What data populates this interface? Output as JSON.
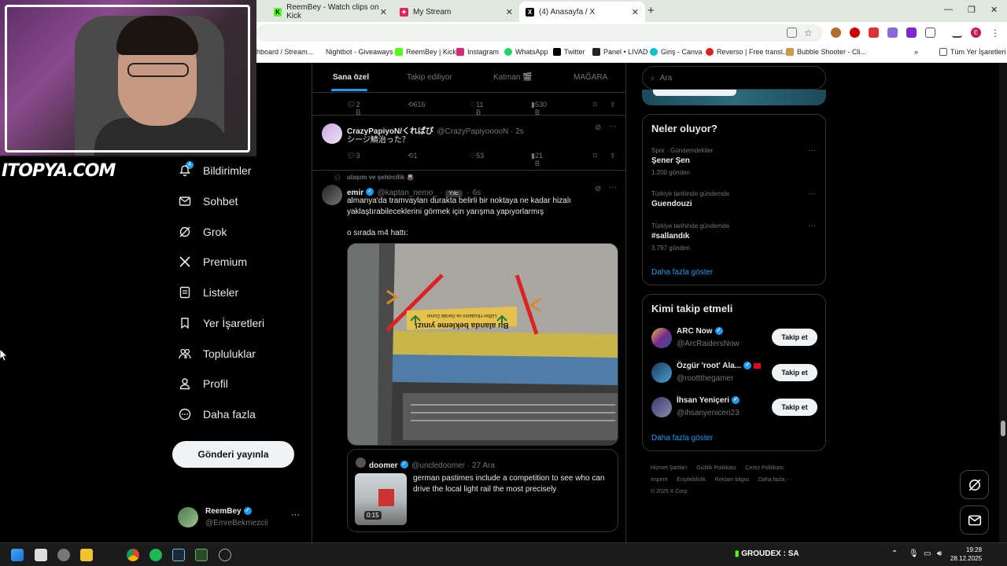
{
  "browser": {
    "tabs": [
      {
        "label": "ReemBey - Watch clips on Kick",
        "fav": "K"
      },
      {
        "label": "My Stream",
        "fav": "✦"
      },
      {
        "label": "(4) Anasayfa / X",
        "fav": "X"
      }
    ],
    "bookmarks": [
      "hboard / Stream...",
      "Nightbot - Giveaways",
      "ReemBey | Kick",
      "Instagram",
      "WhatsApp",
      "Twitter",
      "Panel • LIVAD",
      "Giriş - Canva",
      "Reverso | Free transl...",
      "Bubble Shooter - Cli...",
      "Tüm Yer İşaretleri"
    ],
    "profile_initial": "E"
  },
  "overlay": {
    "logo_text": "ITOPYA.COM"
  },
  "nav": {
    "notif_badge": "4",
    "items": [
      "Bildirimler",
      "Sohbet",
      "Grok",
      "Premium",
      "Listeler",
      "Yer İşaretleri",
      "Topluluklar",
      "Profil",
      "Daha fazla"
    ],
    "post_button": "Gönderi yayınla",
    "account": {
      "name": "ReemBey",
      "handle": "@EmreBekmezcii",
      "more": "···"
    }
  },
  "feed": {
    "tabs": [
      "Sana özel",
      "Takip ediliyor",
      "Katman 🎬",
      "MAĞARA"
    ],
    "prev_actions": {
      "replies": "2 B",
      "reposts": "616",
      "likes": "11 B",
      "views": "530 B"
    },
    "tweet1": {
      "name": "CrazyPapiyoN/くれぱぴ",
      "handle": "@CrazyPapiyooooN · 2s",
      "text": "シージ鯖治った？",
      "replies": "3",
      "reposts": "1",
      "likes": "53",
      "views": "21 B"
    },
    "tweet2": {
      "context": "ulaşım ve şehircilik 🚇",
      "name": "emir",
      "handle": "@kaptan_nemo_ ·",
      "tag": "Yıtc.",
      "time": "6s",
      "text1": "almanya'da tramvayları durakta belirli bir noktaya ne kadar hizalı",
      "text2": "yaklaştırabileceklerini görmek için yarışma yapıyorlarmış",
      "text3": "o sırada m4 hattı:",
      "sign_top": "Lütfen Hizalanın ve Geride Durun",
      "sign_main": "Bu alanda bekleme yınız!",
      "quote": {
        "name": "doomer",
        "handle": "@uncledoomer · 27 Ara",
        "text": "german pastimes include a competition to see who can drive the local light rail the most precisely",
        "duration": "0:15"
      }
    }
  },
  "right": {
    "search_placeholder": "Ara",
    "trends_title": "Neler oluyor?",
    "trends": [
      {
        "cat": "Spor · Gündemdekiler",
        "name": "Şener Şen",
        "count": "1.200 gönderi"
      },
      {
        "cat": "Türkiye tarihinde gündemde",
        "name": "Guendouzi",
        "count": ""
      },
      {
        "cat": "Türkiye tarihinde gündemde",
        "name": "#sallandık",
        "count": "3.797 gönderi"
      }
    ],
    "more": "Daha fazla göster",
    "wtf_title": "Kimi takip etmeli",
    "wtf": [
      {
        "name": "ARC Now",
        "handle": "@ArcRaidersNow",
        "btn": "Takip et"
      },
      {
        "name": "Özgür 'root' Ala...",
        "handle": "@roottthegamer",
        "btn": "Takip et"
      },
      {
        "name": "İhsan Yeniçeri",
        "handle": "@ihsanyeniceri23",
        "btn": "Takip et"
      }
    ],
    "footer": [
      "Hizmet Şartları",
      "Gizlilik Politikası",
      "Çerez Politikası",
      "Imprint",
      "Erişilebilirlik",
      "Reklam bilgisi",
      "Daha fazla ···",
      "© 2025 X Corp."
    ]
  },
  "taskbar": {
    "groudex": "GROUDEX : SA",
    "time": "19:28",
    "date": "28.12.2025"
  },
  "colors": {
    "accent": "#1d9bf0",
    "bg": "#000000",
    "border": "#2f3336",
    "muted": "#71767b"
  }
}
